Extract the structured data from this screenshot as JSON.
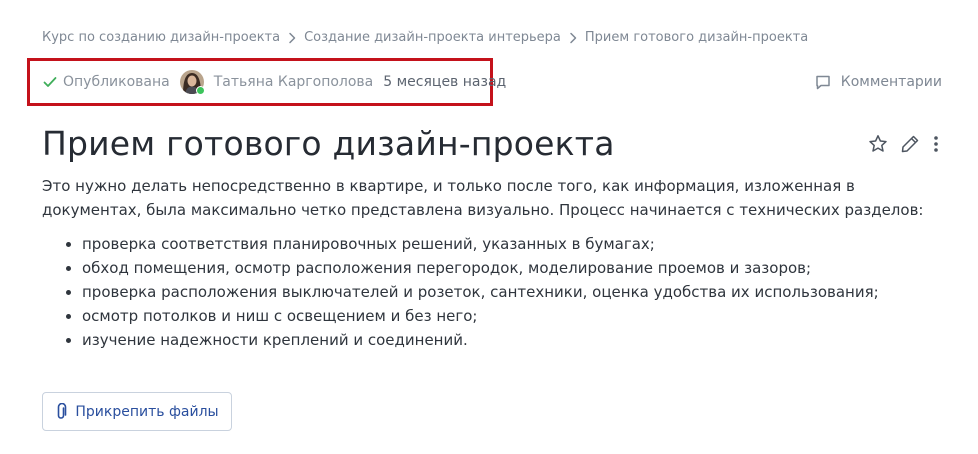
{
  "breadcrumb": {
    "items": [
      "Курс по созданию дизайн-проекта",
      "Создание дизайн-проекта интерьера",
      "Прием готового дизайн-проекта"
    ]
  },
  "meta": {
    "status": "Опубликована",
    "author": "Татьяна Каргополова",
    "time": "5 месяцев назад"
  },
  "comments_label": "Комментарии",
  "page": {
    "title": "Прием готового дизайн-проекта",
    "intro": "Это нужно делать непосредственно в квартире, и только после того, как информация, изложенная в документах, была максимально четко представлена визуально. Процесс начинается с технических разделов:",
    "bullets": [
      "проверка соответствия планировочных решений, указанных в бумагах;",
      "обход помещения, осмотр расположения перегородок, моделирование проемов и зазоров;",
      "проверка расположения выключателей и розеток, сантехники, оценка удобства их использования;",
      "осмотр потолков и ниш с освещением и без него;",
      "изучение надежности креплений и соединений."
    ]
  },
  "attach_label": "Прикрепить файлы",
  "icons": {
    "status": "check-icon",
    "breadcrumb_separator": "chevron-right-icon",
    "comments": "comment-icon",
    "favorite": "star-icon",
    "edit": "pencil-icon",
    "more": "more-vertical-icon",
    "attach": "paperclip-icon"
  },
  "colors": {
    "accent": "#2a4f9e",
    "published": "#3fae5a",
    "highlight_border": "#c4121b",
    "online": "#3cc45b"
  }
}
